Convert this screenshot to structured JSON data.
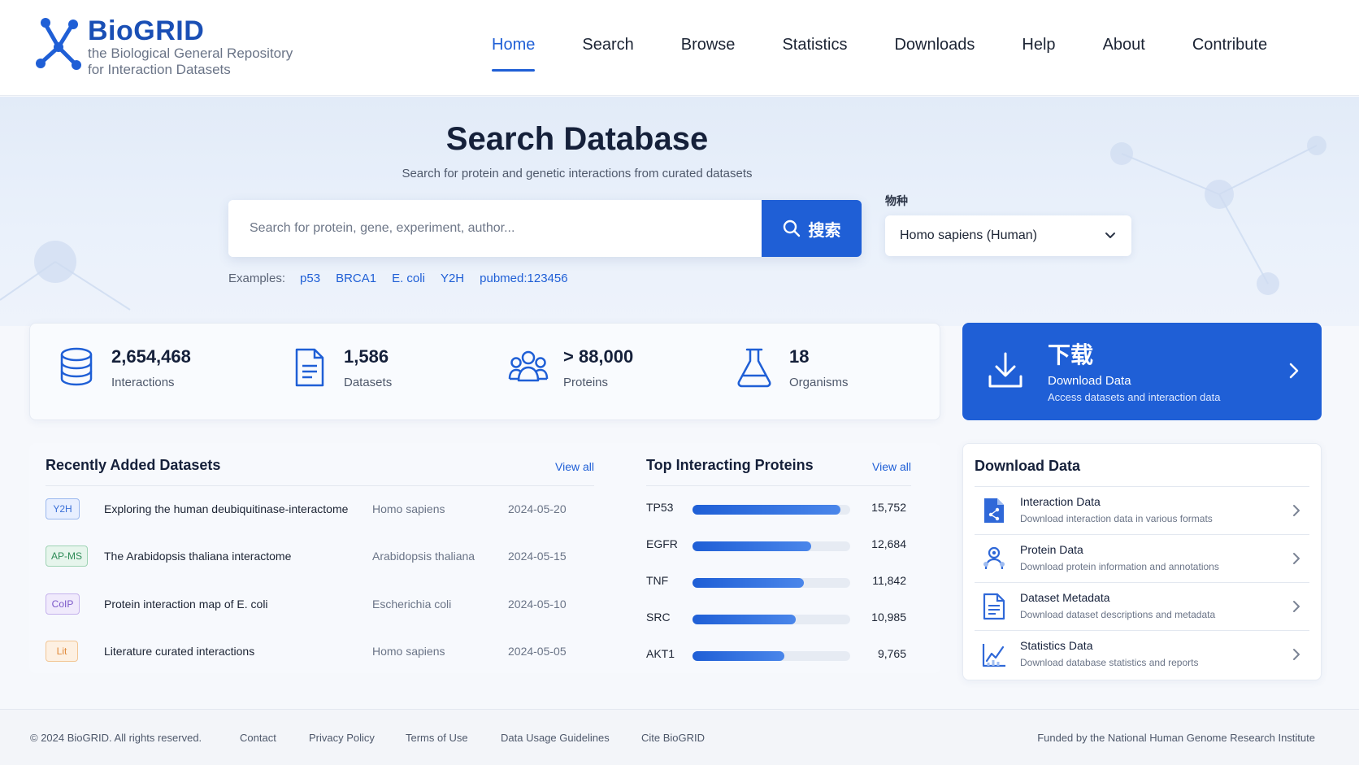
{
  "brand": {
    "name": "BioGRID",
    "subtitle_line1": "the Biological General Repository",
    "subtitle_line2": "for Interaction Datasets",
    "color": "#1a4fb5"
  },
  "nav": {
    "items": [
      "Home",
      "Search",
      "Browse",
      "Statistics",
      "Downloads",
      "Help",
      "About",
      "Contribute"
    ],
    "active": "Home"
  },
  "hero": {
    "title": "Search Database",
    "subtitle": "Search for protein and genetic interactions from curated datasets",
    "search_placeholder": "Search for protein, gene, experiment, author...",
    "search_button": "搜索",
    "species_label": "物种",
    "species_value": "Homo sapiens (Human)",
    "examples_label": "Examples:",
    "examples": [
      "p53",
      "BRCA1",
      "E. coli",
      "Y2H",
      "pubmed:123456"
    ]
  },
  "stats": [
    {
      "value": "2,654,468",
      "label": "Interactions",
      "icon": "database-icon"
    },
    {
      "value": "1,586",
      "label": "Datasets",
      "icon": "document-icon"
    },
    {
      "value": "> 88,000",
      "label": "Proteins",
      "icon": "people-icon"
    },
    {
      "value": "18",
      "label": "Organisms",
      "icon": "flask-icon"
    }
  ],
  "cta": {
    "title": "下载",
    "subtitle": "Download Data",
    "description": "Access datasets and interaction data"
  },
  "recent": {
    "title": "Recently Added Datasets",
    "view_all": "View all",
    "rows": [
      {
        "tag": "Y2H",
        "tag_color": "#3a6fd8",
        "tag_bg": "#e8efff",
        "name": "Exploring the human deubiquitinase-interactome",
        "organism": "Homo sapiens",
        "date": "2024-05-20"
      },
      {
        "tag": "AP-MS",
        "tag_color": "#2e8b57",
        "tag_bg": "#e6f5ec",
        "name": "The Arabidopsis thaliana interactome",
        "organism": "Arabidopsis thaliana",
        "date": "2024-05-15"
      },
      {
        "tag": "CoIP",
        "tag_color": "#7a57c8",
        "tag_bg": "#f0eafc",
        "name": "Protein interaction map of E. coli",
        "organism": "Escherichia coli",
        "date": "2024-05-10"
      },
      {
        "tag": "Lit",
        "tag_color": "#e08a3a",
        "tag_bg": "#fdf0e2",
        "name": "Literature curated interactions",
        "organism": "Homo sapiens",
        "date": "2024-05-05"
      }
    ]
  },
  "top_proteins": {
    "title": "Top Interacting Proteins",
    "view_all": "View all",
    "max": 16800,
    "rows": [
      {
        "name": "TP53",
        "count": "15,752",
        "value": 15752
      },
      {
        "name": "EGFR",
        "count": "12,684",
        "value": 12684
      },
      {
        "name": "TNF",
        "count": "11,842",
        "value": 11842
      },
      {
        "name": "SRC",
        "count": "10,985",
        "value": 10985
      },
      {
        "name": "AKT1",
        "count": "9,765",
        "value": 9765
      }
    ]
  },
  "download_panel": {
    "title": "Download Data",
    "items": [
      {
        "title": "Interaction Data",
        "desc": "Download interaction data in various formats",
        "icon": "interaction-file-icon"
      },
      {
        "title": "Protein Data",
        "desc": "Download protein information and annotations",
        "icon": "protein-icon"
      },
      {
        "title": "Dataset Metadata",
        "desc": "Download dataset descriptions and metadata",
        "icon": "metadata-file-icon"
      },
      {
        "title": "Statistics Data",
        "desc": "Download database statistics and reports",
        "icon": "chart-icon"
      }
    ]
  },
  "footer": {
    "copyright": "© 2024 BioGRID. All rights reserved.",
    "links": [
      "Contact",
      "Privacy Policy",
      "Terms of Use",
      "Data Usage Guidelines",
      "Cite BioGRID"
    ],
    "funding": "Funded by the National Human Genome Research Institute"
  },
  "colors": {
    "primary": "#1f5fd6",
    "text": "#15203a",
    "muted": "#6a7487"
  }
}
